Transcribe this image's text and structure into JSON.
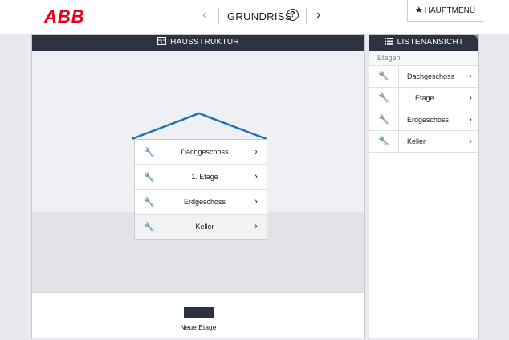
{
  "brand": "ABB",
  "header": {
    "title": "GRUNDRISS",
    "prev": "‹",
    "next": "›",
    "help": "?"
  },
  "main_menu": {
    "label": "HAUPTMENÜ",
    "icon": "★"
  },
  "house_panel": {
    "title": "HAUSSTRUKTUR",
    "floors": [
      {
        "label": "Dachgeschoss"
      },
      {
        "label": "1. Etage"
      },
      {
        "label": "Erdgeschoss"
      },
      {
        "label": "Keller"
      }
    ],
    "new_floor_label": "Neue Etage"
  },
  "list_panel": {
    "title": "LISTENANSICHT",
    "subheader": "Etagen",
    "floors": [
      {
        "label": "Dachgeschoss"
      },
      {
        "label": "1. Etage"
      },
      {
        "label": "Erdgeschoss"
      },
      {
        "label": "Keller"
      }
    ]
  },
  "glyphs": {
    "wrench": "🔧",
    "chevron": "›"
  },
  "colors": {
    "header_bg": "#2b3440",
    "roof": "#1f6fb5",
    "brand": "#e2001a"
  }
}
